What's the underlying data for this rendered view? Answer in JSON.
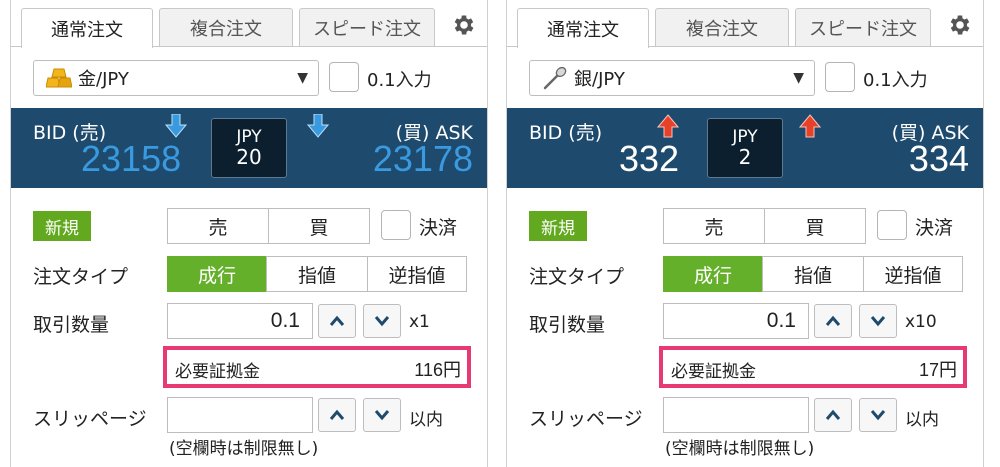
{
  "panels": [
    {
      "tabs": [
        "通常注文",
        "複合注文",
        "スピード注文"
      ],
      "symbol": "金/JPY",
      "symbol_icon": "gold-bar-icon",
      "point_one_input_label": "0.1入力",
      "bid_label": "BID (売)",
      "ask_label": "(買) ASK",
      "bid_price": "23158",
      "ask_price": "23178",
      "spread_currency": "JPY",
      "spread_value": "20",
      "price_direction": "down",
      "price_color": "#3a9ae0",
      "new_badge": "新規",
      "sell_label": "売",
      "buy_label": "買",
      "settle_label": "決済",
      "order_type_label": "注文タイプ",
      "order_types": [
        "成行",
        "指値",
        "逆指値"
      ],
      "quantity_label": "取引数量",
      "quantity_value": "0.1",
      "multiplier": "x1",
      "margin_label": "必要証拠金",
      "margin_value": "116円",
      "slippage_label": "スリッページ",
      "within_label": "以内",
      "slippage_note": "(空欄時は制限無し)"
    },
    {
      "tabs": [
        "通常注文",
        "複合注文",
        "スピード注文"
      ],
      "symbol": "銀/JPY",
      "symbol_icon": "silver-spoon-icon",
      "point_one_input_label": "0.1入力",
      "bid_label": "BID (売)",
      "ask_label": "(買) ASK",
      "bid_price": "332",
      "ask_price": "334",
      "spread_currency": "JPY",
      "spread_value": "2",
      "price_direction": "up",
      "price_color": "#ffffff",
      "new_badge": "新規",
      "sell_label": "売",
      "buy_label": "買",
      "settle_label": "決済",
      "order_type_label": "注文タイプ",
      "order_types": [
        "成行",
        "指値",
        "逆指値"
      ],
      "quantity_label": "取引数量",
      "quantity_value": "0.1",
      "multiplier": "x10",
      "margin_label": "必要証拠金",
      "margin_value": "17円",
      "slippage_label": "スリッページ",
      "within_label": "以内",
      "slippage_note": "(空欄時は制限無し)"
    }
  ],
  "colors": {
    "quote_bar": "#1e4a6d",
    "active_green": "#65b02a",
    "highlight": "#e83a72",
    "down_arrow": "#3a9ae0",
    "up_arrow": "#e8412a"
  }
}
